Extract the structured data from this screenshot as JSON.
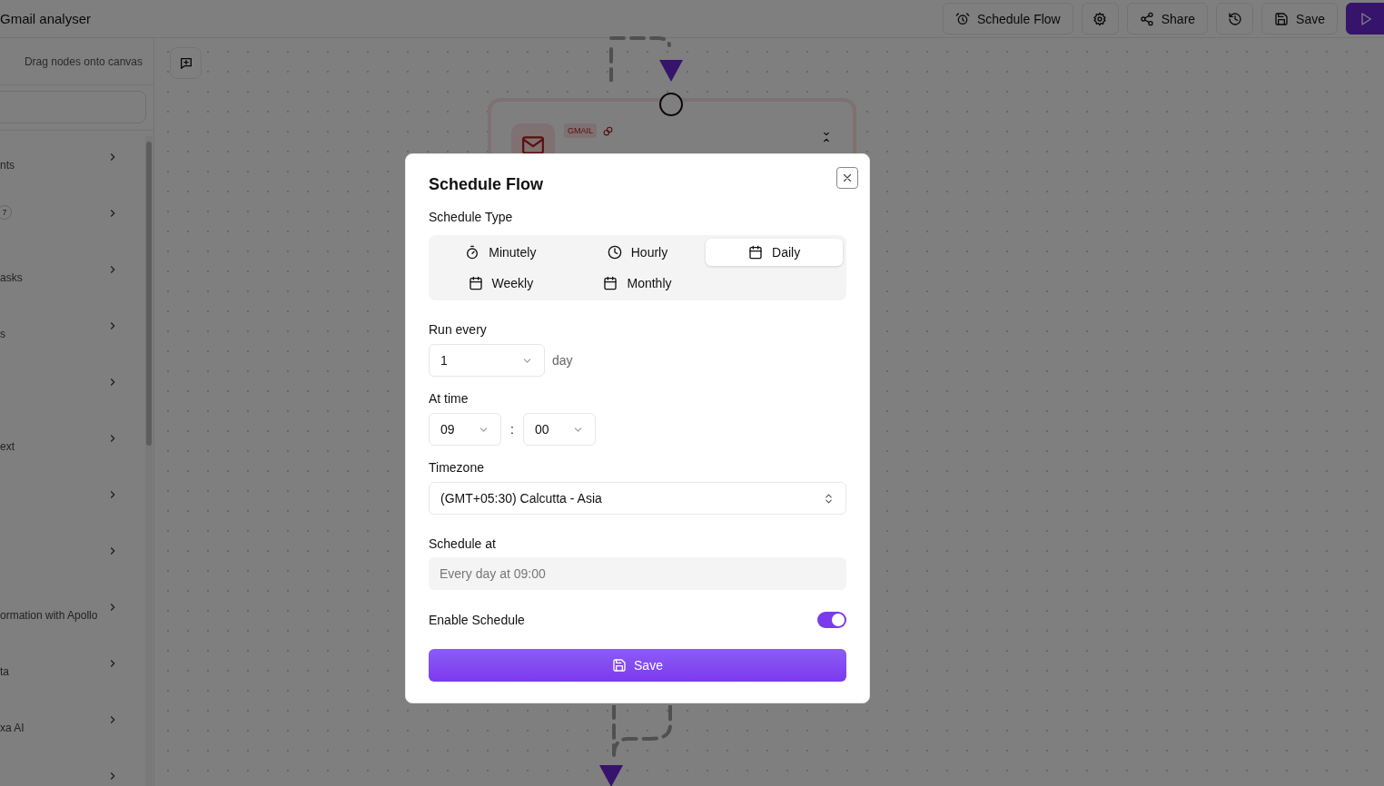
{
  "header": {
    "title": "Gmail analyser",
    "buttons": [
      {
        "kind": "schedule",
        "label": "Schedule Flow"
      },
      {
        "kind": "settings"
      },
      {
        "kind": "share",
        "label": "Share"
      },
      {
        "kind": "history"
      },
      {
        "kind": "save",
        "label": "Save"
      },
      {
        "kind": "run"
      }
    ]
  },
  "sidebar": {
    "hint": "Drag nodes onto canvas",
    "items": [
      {
        "kind": "text",
        "label": "nts"
      },
      {
        "kind": "badge",
        "badge": "7"
      },
      {
        "kind": "text",
        "label": "asks"
      },
      {
        "kind": "text",
        "label": "s"
      },
      {
        "kind": "blank"
      },
      {
        "kind": "text",
        "label": "ext"
      },
      {
        "kind": "blank"
      },
      {
        "kind": "blank"
      },
      {
        "kind": "text",
        "label": "ormation with Apollo"
      },
      {
        "kind": "text",
        "label": "ta"
      },
      {
        "kind": "text",
        "label": "xa AI"
      },
      {
        "kind": "blank"
      }
    ]
  },
  "canvas": {
    "node": {
      "tag": "GMAIL"
    }
  },
  "dialog": {
    "title": "Schedule Flow",
    "type_label": "Schedule Type",
    "types": [
      {
        "kind": "stopwatch",
        "label": "Minutely",
        "selected": false
      },
      {
        "kind": "clock",
        "label": "Hourly",
        "selected": false
      },
      {
        "kind": "calendar",
        "label": "Daily",
        "selected": true
      },
      {
        "kind": "calendar",
        "label": "Weekly",
        "selected": false
      },
      {
        "kind": "calendar",
        "label": "Monthly",
        "selected": false
      }
    ],
    "run_every": {
      "label": "Run every",
      "value": "1",
      "unit": "day"
    },
    "at_time": {
      "label": "At time",
      "hour": "09",
      "separator": ":",
      "minute": "00"
    },
    "timezone": {
      "label": "Timezone",
      "value": "(GMT+05:30) Calcutta - Asia"
    },
    "schedule_at": {
      "label": "Schedule at",
      "value": "Every day at 09:00"
    },
    "enable": {
      "label": "Enable Schedule",
      "on": true
    },
    "save": "Save"
  }
}
